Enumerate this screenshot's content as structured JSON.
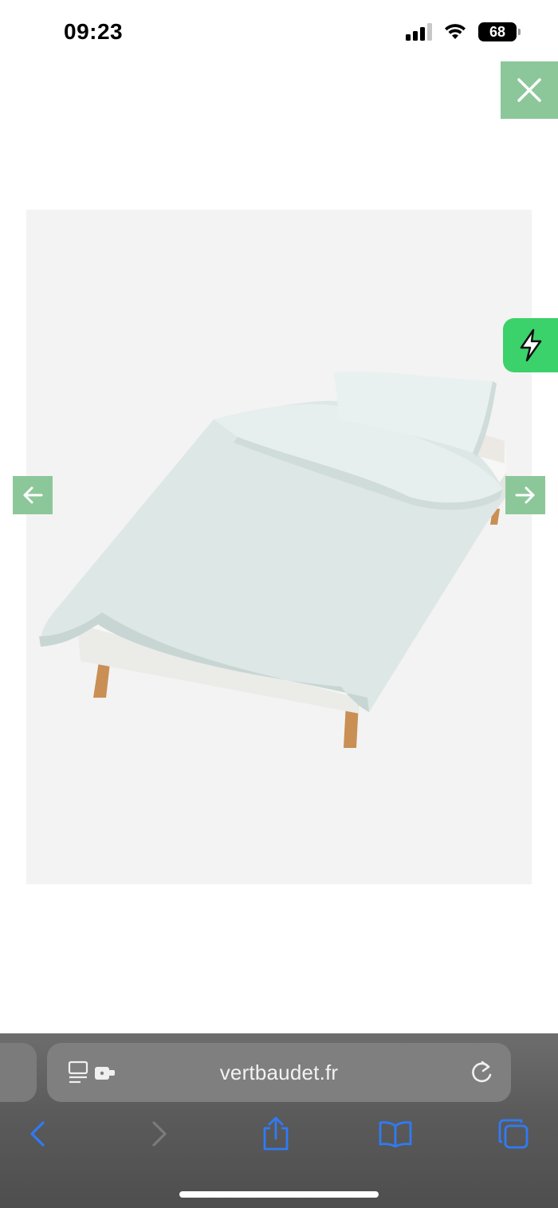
{
  "status_bar": {
    "time": "09:23",
    "battery": "68"
  },
  "icons": {
    "close": "close-icon",
    "prev": "arrow-left-icon",
    "next": "arrow-right-icon",
    "quick_action": "lightning-icon",
    "reader": "reader-mode-icon",
    "extension": "extension-icon",
    "reload": "reload-icon",
    "back": "chevron-left-icon",
    "forward": "chevron-right-icon",
    "share": "share-icon",
    "bookmarks": "book-icon",
    "tabs": "tabs-icon"
  },
  "browser": {
    "url": "vertbaudet.fr"
  },
  "colors": {
    "accent": "#8cc79a",
    "quick_action": "#3bd16b",
    "toolbar_icon": "#2f7bf5"
  }
}
